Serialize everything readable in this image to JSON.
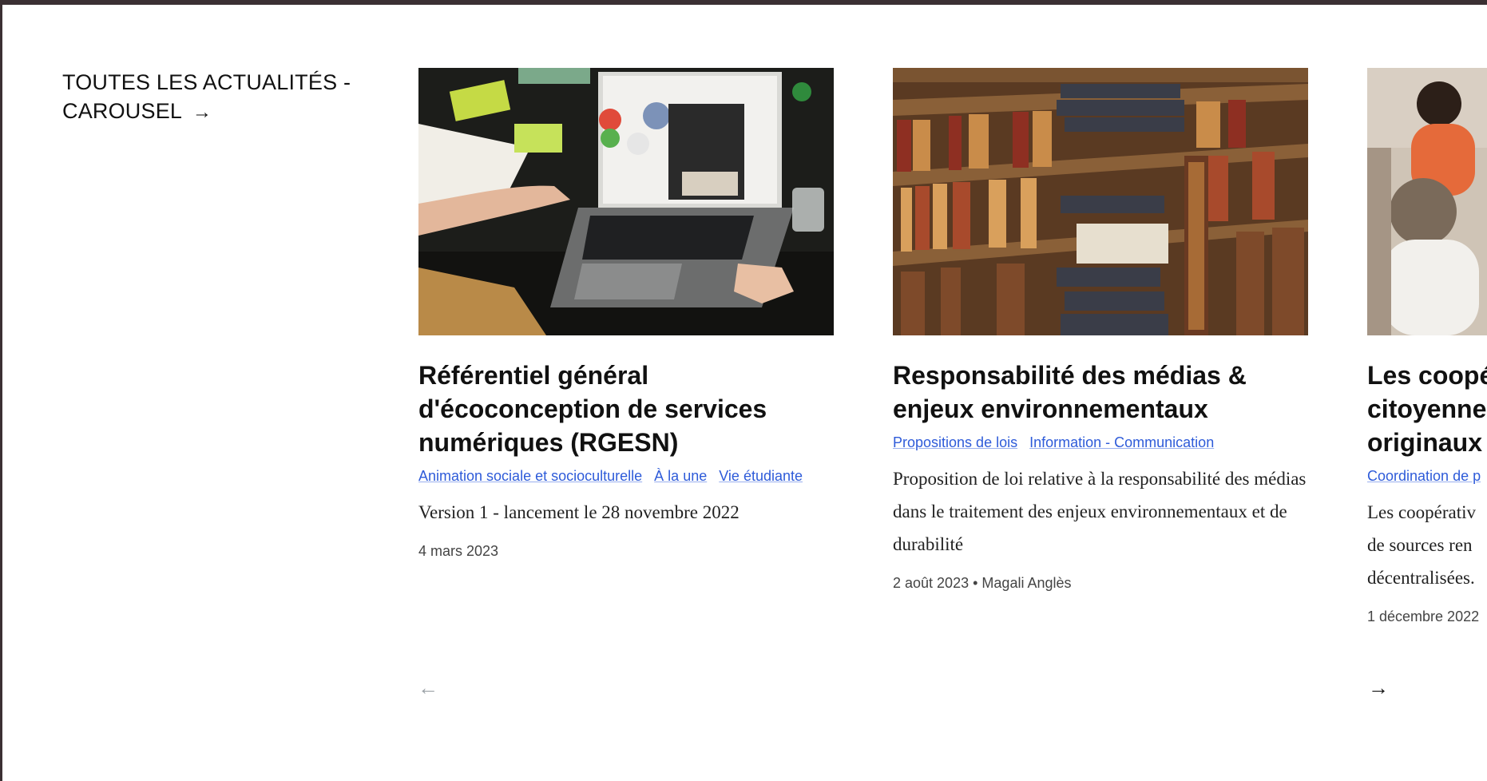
{
  "section": {
    "title_line1": "TOUTES LES ACTUALITÉS -",
    "title_line2": "CAROUSEL",
    "arrow": "→"
  },
  "cards": [
    {
      "image": "laptop-workspace-image",
      "title": "Référentiel général d'écoconception de services numériques (RGESN)",
      "tags": [
        "Animation sociale et socioculturelle",
        "À la une",
        "Vie étudiante"
      ],
      "description": "Version 1 - lancement le 28 novembre 2022",
      "date": "4 mars 2023",
      "author": ""
    },
    {
      "image": "library-bookshelf-image",
      "title": "Responsabilité des médias & enjeux environnementaux",
      "tags": [
        "Propositions de lois",
        "Information - Communication"
      ],
      "description": "Proposition de loi relative à la responsabilité des médias dans le traitement des enjeux environnementaux et de durabilité",
      "date": "2 août 2023",
      "author": "Magali Anglès"
    },
    {
      "image": "people-meeting-image",
      "title": "Les coopé citoyenne originaux",
      "tags": [
        "Coordination de p"
      ],
      "description": "Les coopérativ de sources ren décentralisées.",
      "date": "1 décembre 2022",
      "author": ""
    }
  ],
  "nav": {
    "prev_icon": "←",
    "next_icon": "→"
  },
  "colors": {
    "link": "#2e5bd9",
    "frame": "#3b3033"
  }
}
